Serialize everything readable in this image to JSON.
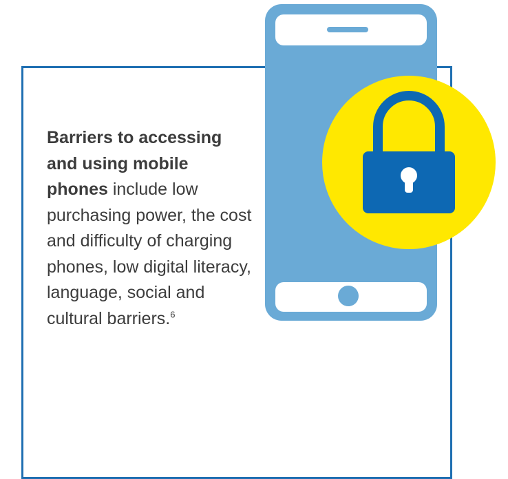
{
  "colors": {
    "frame": "#1f6fb2",
    "phone": "#6aaad6",
    "lock_badge": "#ffe800",
    "lock": "#0d68b3",
    "text": "#3c3c3c"
  },
  "icons": {
    "phone": "smartphone-icon",
    "lock": "padlock-icon"
  },
  "text": {
    "bold_part": "Barriers to accessing and using mobile phones",
    "regular_part": " include low purchasing power, the cost and difficulty of charging phones, low digital literacy, language, social and cultural barriers.",
    "footnote": "6"
  }
}
